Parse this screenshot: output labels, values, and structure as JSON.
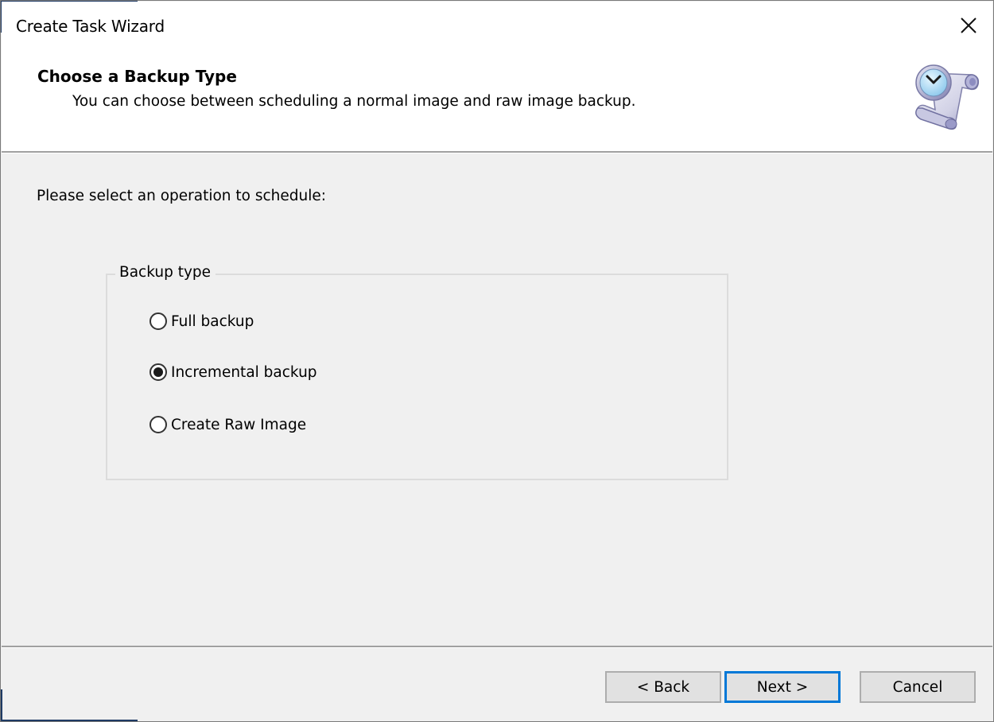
{
  "window": {
    "title": "Create Task Wizard",
    "close_icon": "close-icon"
  },
  "header": {
    "title": "Choose a Backup Type",
    "subtitle": "You can choose between scheduling a normal image and raw image backup.",
    "icon": "scheduled-task-clock-scroll-icon"
  },
  "main": {
    "instruction": "Please select an operation to schedule:",
    "group": {
      "legend": "Backup type",
      "options": [
        {
          "label": "Full backup",
          "selected": false
        },
        {
          "label": "Incremental backup",
          "selected": true
        },
        {
          "label": "Create Raw Image",
          "selected": false
        }
      ]
    }
  },
  "footer": {
    "back_label": "< Back",
    "next_label": "Next >",
    "cancel_label": "Cancel",
    "default_button": "next"
  },
  "colors": {
    "focus_border": "#0078d7",
    "dialog_bg": "#f0f0f0",
    "header_bg": "#ffffff"
  }
}
